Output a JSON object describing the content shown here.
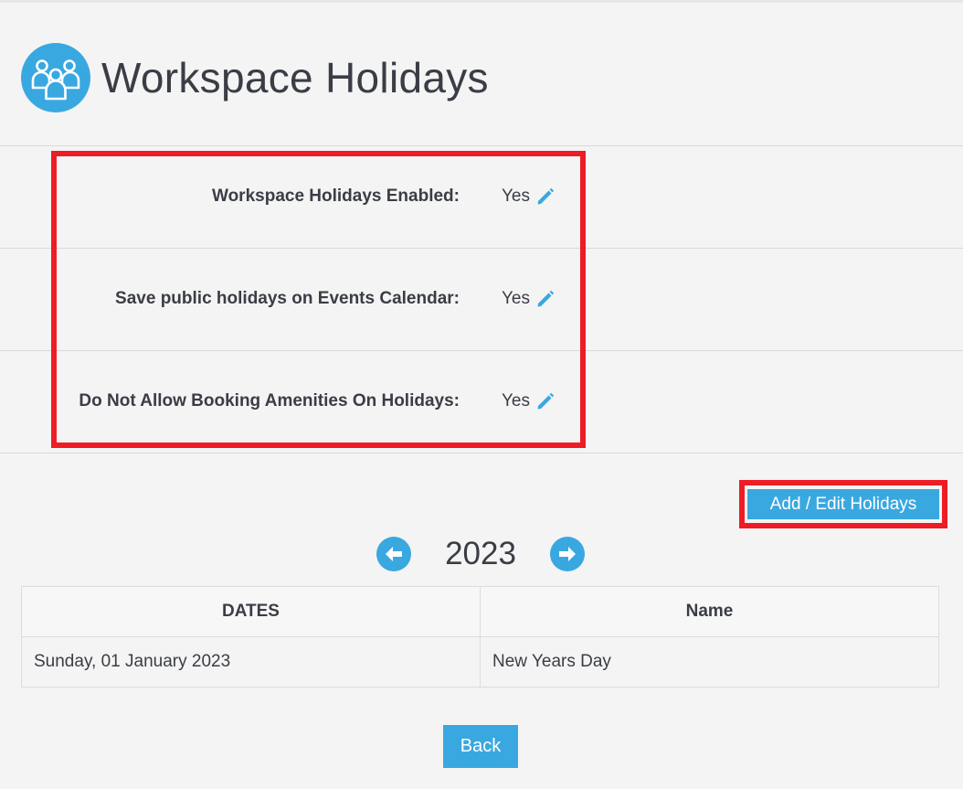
{
  "header": {
    "title": "Workspace Holidays",
    "icon": "people-group-icon"
  },
  "settings": [
    {
      "label": "Workspace Holidays Enabled:",
      "value": "Yes"
    },
    {
      "label": "Save public holidays on Events Calendar:",
      "value": "Yes"
    },
    {
      "label": "Do Not Allow Booking Amenities On Holidays:",
      "value": "Yes"
    }
  ],
  "actions": {
    "add_edit_label": "Add / Edit Holidays",
    "back_label": "Back"
  },
  "year_nav": {
    "year": "2023",
    "prev_icon": "arrow-left-circle-icon",
    "next_icon": "arrow-right-circle-icon"
  },
  "table": {
    "columns": [
      "DATES",
      "Name"
    ],
    "rows": [
      [
        "Sunday, 01 January 2023",
        "New Years Day"
      ]
    ]
  },
  "colors": {
    "accent": "#3aa8e0",
    "highlight": "#ee1c24",
    "text": "#3a3d45",
    "background": "#f4f4f4"
  }
}
